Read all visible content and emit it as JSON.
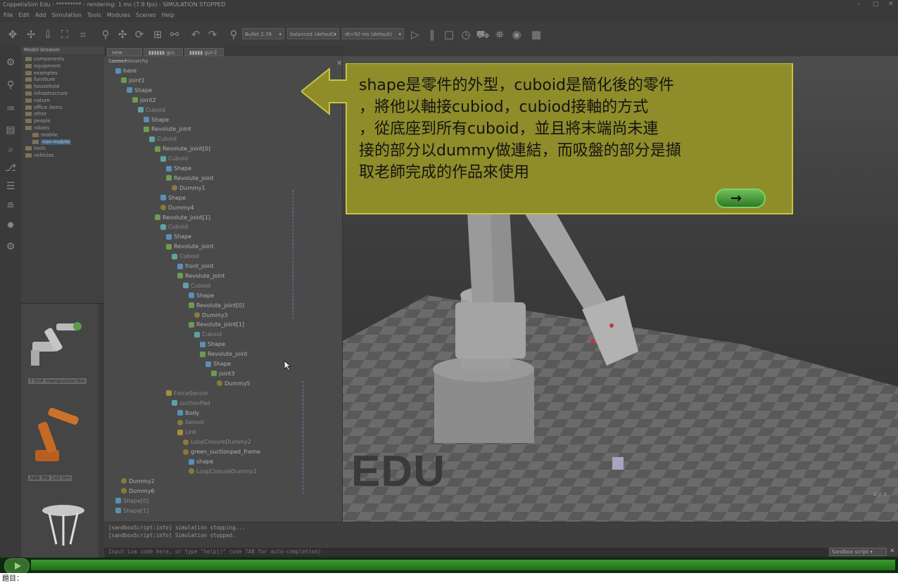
{
  "window": {
    "title": "CoppeliaSim Edu - ********* - rendering: 1 ms (7.9 fps) - SIMULATION STOPPED"
  },
  "menu": [
    "File",
    "Edit",
    "Add",
    "Simulation",
    "Tools",
    "Modules",
    "Scenes",
    "Help"
  ],
  "toolbar": {
    "engine": "Bullet 2.78",
    "accuracy": "balanced (default)",
    "timestep": "dt=50 ms (default)"
  },
  "model_browser": {
    "title": "Model browser",
    "items": [
      {
        "label": "components",
        "selected": false
      },
      {
        "label": "equipment",
        "selected": false
      },
      {
        "label": "examples",
        "selected": false
      },
      {
        "label": "furniture",
        "selected": false
      },
      {
        "label": "household",
        "selected": false
      },
      {
        "label": "infrastructure",
        "selected": false
      },
      {
        "label": "nature",
        "selected": false
      },
      {
        "label": "office items",
        "selected": false
      },
      {
        "label": "other",
        "selected": false
      },
      {
        "label": "people",
        "selected": false
      },
      {
        "label": "robots",
        "selected": false
      },
      {
        "label": "mobile",
        "selected": false
      },
      {
        "label": "non-mobile",
        "selected": true
      },
      {
        "label": "tools",
        "selected": false
      },
      {
        "label": "vehicles",
        "selected": false
      }
    ],
    "thumbnails": [
      "7 DoF manipulator.ttm",
      "ABB IRB 140.ttm"
    ]
  },
  "scene_tabs": [
    "new scene",
    "▮▮▮▮▮▮ gui.",
    "▮▮▮▮▮ gui-2"
  ],
  "scene_hierarchy": {
    "title": "Scene hierarchy",
    "nodes": [
      {
        "label": "base",
        "type": "shape",
        "dim": false
      },
      {
        "label": "joint1",
        "type": "joint",
        "dim": false
      },
      {
        "label": "Shape",
        "type": "shape",
        "dim": false
      },
      {
        "label": "joint2",
        "type": "joint",
        "dim": false
      },
      {
        "label": "Cuboid",
        "type": "cuboid",
        "dim": true
      },
      {
        "label": "Shape",
        "type": "shape",
        "dim": false
      },
      {
        "label": "Revolute_joint",
        "type": "joint",
        "dim": false
      },
      {
        "label": "Cuboid",
        "type": "cuboid",
        "dim": true
      },
      {
        "label": "Revolute_joint[0]",
        "type": "joint",
        "dim": false
      },
      {
        "label": "Cuboid",
        "type": "cuboid",
        "dim": true
      },
      {
        "label": "Shape",
        "type": "shape",
        "dim": false
      },
      {
        "label": "Revolute_joint",
        "type": "joint",
        "dim": false
      },
      {
        "label": "Dummy1",
        "type": "dummy",
        "dim": false
      },
      {
        "label": "Shape",
        "type": "shape",
        "dim": false
      },
      {
        "label": "Dummy4",
        "type": "dummy",
        "dim": false
      },
      {
        "label": "Revolute_joint[1]",
        "type": "joint",
        "dim": false
      },
      {
        "label": "Cuboid",
        "type": "cuboid",
        "dim": true
      },
      {
        "label": "Shape",
        "type": "shape",
        "dim": false
      },
      {
        "label": "Revolute_joint",
        "type": "joint",
        "dim": false
      },
      {
        "label": "Cuboid",
        "type": "cuboid",
        "dim": true
      },
      {
        "label": "front_joint",
        "type": "shape",
        "dim": false
      },
      {
        "label": "Revolute_joint",
        "type": "joint",
        "dim": false
      },
      {
        "label": "Cuboid",
        "type": "cuboid",
        "dim": true
      },
      {
        "label": "Shape",
        "type": "shape",
        "dim": false
      },
      {
        "label": "Revolute_joint[0]",
        "type": "joint",
        "dim": false
      },
      {
        "label": "Dummy3",
        "type": "dummy",
        "dim": false
      },
      {
        "label": "Revolute_joint[1]",
        "type": "joint",
        "dim": false
      },
      {
        "label": "Cuboid",
        "type": "cuboid",
        "dim": true
      },
      {
        "label": "Shape",
        "type": "shape",
        "dim": false
      },
      {
        "label": "Revolute_joint",
        "type": "joint",
        "dim": false
      },
      {
        "label": "Shape",
        "type": "shape",
        "dim": false
      },
      {
        "label": "joint3",
        "type": "joint",
        "dim": false
      },
      {
        "label": "Dummy5",
        "type": "dummy",
        "dim": false
      },
      {
        "label": "ForceSensor",
        "type": "force",
        "dim": true
      },
      {
        "label": "suctionPad",
        "type": "cuboid",
        "dim": true
      },
      {
        "label": "Body",
        "type": "shape",
        "dim": false
      },
      {
        "label": "Sensor",
        "type": "dummy",
        "dim": true
      },
      {
        "label": "Link",
        "type": "force",
        "dim": true
      },
      {
        "label": "LoopClosureDummy2",
        "type": "dummy",
        "dim": true
      },
      {
        "label": "green_suctionpad_frame",
        "type": "dummy",
        "dim": false
      },
      {
        "label": "shape",
        "type": "shape",
        "dim": false
      },
      {
        "label": "LoopClosureDummy1",
        "type": "dummy",
        "dim": true
      },
      {
        "label": "Dummy2",
        "type": "dummy",
        "dim": false
      },
      {
        "label": "Dummy6",
        "type": "dummy",
        "dim": false
      },
      {
        "label": "Shape[0]",
        "type": "shape",
        "dim": true
      },
      {
        "label": "Shape[1]",
        "type": "shape",
        "dim": true
      }
    ]
  },
  "viewport": {
    "watermark": "EDU",
    "axes_label": "z y x"
  },
  "console": {
    "lines": [
      "[sandboxScript:info] simulation stopping...",
      "[sandboxScript:info] Simulation stopped."
    ],
    "input_placeholder": "Input Lua code here, or type \"help()\" (use TAB for auto-completion)",
    "script_select": "Sandbox script",
    "close": "✕"
  },
  "callout": {
    "text_lines": [
      "shape是零件的外型，cuboid是簡化後的零件",
      "，將他以軸接cubiod，cubiod接軸的方式",
      "，從底座到所有cuboid，並且將末端尚未連",
      "接的部分以dummy做連結，而吸盤的部分是擷",
      "取老師完成的作品來使用"
    ],
    "next_icon": "→"
  },
  "player": {
    "progress": 1.0
  },
  "footer": {
    "text": "題目："
  },
  "colors": {
    "callout_fill": "#8f8c2a",
    "callout_border": "#c9c440",
    "progress": "#2f8a24"
  }
}
